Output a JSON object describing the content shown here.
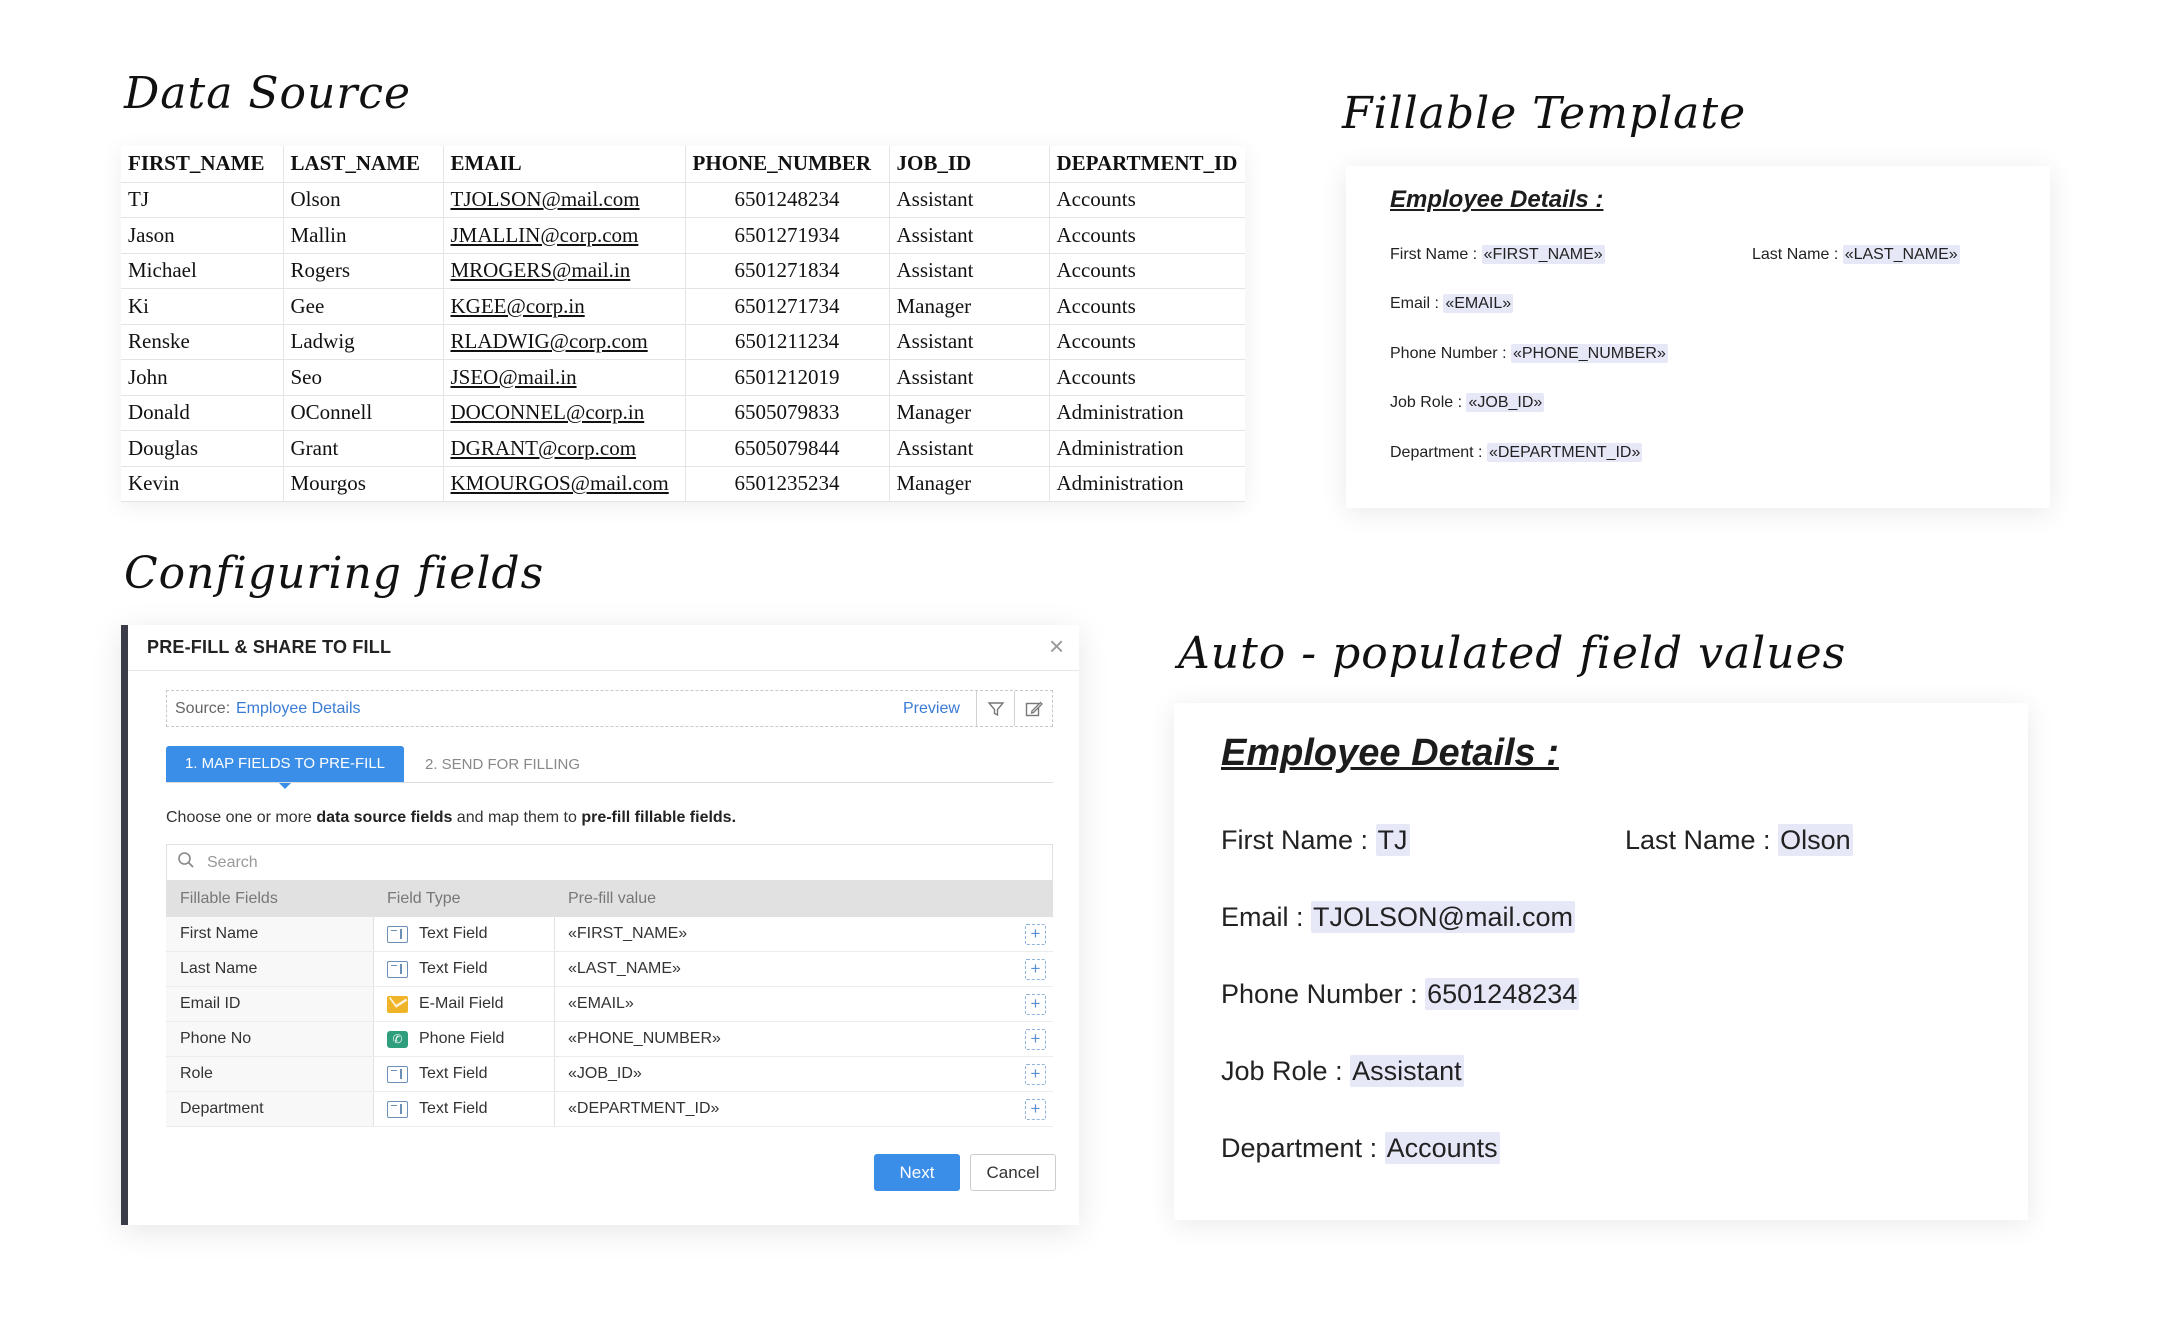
{
  "headings": {
    "data_source": "Data Source",
    "fillable_template": "Fillable Template",
    "configuring": "Configuring fields",
    "auto": "Auto - populated field values"
  },
  "data_source": {
    "columns": [
      "FIRST_NAME",
      "LAST_NAME",
      "EMAIL",
      "PHONE_NUMBER",
      "JOB_ID",
      "DEPARTMENT_ID"
    ],
    "rows": [
      [
        "TJ",
        "Olson",
        "TJOLSON@mail.com",
        "6501248234",
        "Assistant",
        "Accounts"
      ],
      [
        "Jason",
        "Mallin",
        "JMALLIN@corp.com",
        "6501271934",
        "Assistant",
        "Accounts"
      ],
      [
        "Michael",
        "Rogers",
        "MROGERS@mail.in",
        "6501271834",
        "Assistant",
        "Accounts"
      ],
      [
        "Ki",
        "Gee",
        "KGEE@corp.in",
        "6501271734",
        "Manager",
        "Accounts"
      ],
      [
        "Renske",
        "Ladwig",
        "RLADWIG@corp.com",
        "6501211234",
        "Assistant",
        "Accounts"
      ],
      [
        "John",
        "Seo",
        "JSEO@mail.in",
        "6501212019",
        "Assistant",
        "Accounts"
      ],
      [
        "Donald",
        "OConnell",
        "DOCONNEL@corp.in",
        "6505079833",
        "Manager",
        "Administration"
      ],
      [
        "Douglas",
        "Grant",
        "DGRANT@corp.com",
        "6505079844",
        "Assistant",
        "Administration"
      ],
      [
        "Kevin",
        "Mourgos",
        "KMOURGOS@mail.com",
        "6501235234",
        "Manager",
        "Administration"
      ]
    ]
  },
  "template": {
    "title": "Employee Details :",
    "first_name_label": "First Name : ",
    "first_name_token": "«FIRST_NAME»",
    "last_name_label": "Last Name : ",
    "last_name_token": "«LAST_NAME»",
    "email_label": "Email : ",
    "email_token": "«EMAIL»",
    "phone_label": "Phone Number : ",
    "phone_token": "«PHONE_NUMBER»",
    "job_label": "Job Role : ",
    "job_token": "«JOB_ID»",
    "dept_label": "Department : ",
    "dept_token": "«DEPARTMENT_ID»"
  },
  "dialog": {
    "title": "PRE-FILL & SHARE TO FILL",
    "source_label": "Source:",
    "source_value": "Employee Details",
    "preview": "Preview",
    "tab1": "1. MAP FIELDS TO PRE-FILL",
    "tab2": "2. SEND FOR FILLING",
    "instr_a": "Choose one or more ",
    "instr_b": "data source fields",
    "instr_c": " and map them to ",
    "instr_d": "pre-fill fillable fields.",
    "search_placeholder": "Search",
    "columns": [
      "Fillable Fields",
      "Field Type",
      "Pre-fill value"
    ],
    "rows": [
      {
        "field": "First Name",
        "type": "Text Field",
        "icon": "text-field-icon",
        "value": "«FIRST_NAME»"
      },
      {
        "field": "Last Name",
        "type": "Text Field",
        "icon": "text-field-icon",
        "value": "«LAST_NAME»"
      },
      {
        "field": "Email ID",
        "type": "E-Mail Field",
        "icon": "email-field-icon",
        "value": "«EMAIL»"
      },
      {
        "field": "Phone No",
        "type": "Phone Field",
        "icon": "phone-field-icon",
        "value": "«PHONE_NUMBER»"
      },
      {
        "field": "Role",
        "type": "Text Field",
        "icon": "text-field-icon",
        "value": "«JOB_ID»"
      },
      {
        "field": "Department",
        "type": "Text Field",
        "icon": "text-field-icon",
        "value": "«DEPARTMENT_ID»"
      }
    ],
    "next": "Next",
    "cancel": "Cancel",
    "accent": "#3b8ee8"
  },
  "auto": {
    "title": "Employee Details :",
    "first_name_label": "First Name : ",
    "first_name_value": "TJ",
    "last_name_label": "Last Name : ",
    "last_name_value": "Olson",
    "email_label": "Email : ",
    "email_value": "TJOLSON@mail.com",
    "phone_label": "Phone Number : ",
    "phone_value": "6501248234",
    "job_label": "Job Role : ",
    "job_value": "Assistant",
    "dept_label": "Department : ",
    "dept_value": "Accounts"
  }
}
